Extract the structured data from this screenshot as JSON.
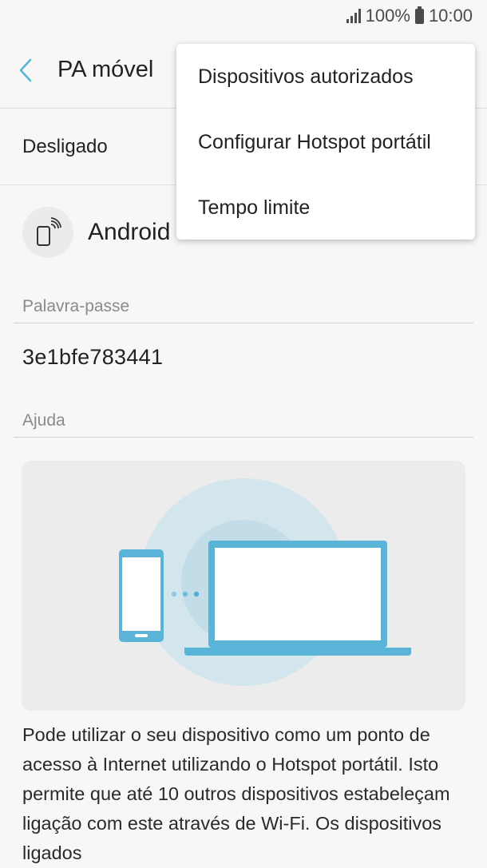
{
  "status_bar": {
    "battery": "100%",
    "time": "10:00"
  },
  "header": {
    "title": "PA móvel"
  },
  "hotspot_status": {
    "label": "Desligado"
  },
  "network": {
    "name": "Android"
  },
  "password": {
    "label": "Palavra-passe",
    "value": "3e1bfe783441"
  },
  "help": {
    "label": "Ajuda",
    "text": "Pode utilizar o seu dispositivo como um ponto de acesso à Internet utilizando o Hotspot portátil. Isto permite que até 10 outros dispositivos estabeleçam ligação com este através de Wi-Fi. Os dispositivos ligados"
  },
  "overflow_menu": {
    "items": [
      {
        "label": "Dispositivos autorizados"
      },
      {
        "label": "Configurar Hotspot portátil"
      },
      {
        "label": "Tempo limite"
      }
    ]
  },
  "colors": {
    "accent": "#5ab4d8",
    "circle_outer": "#cfe4ec",
    "circle_inner": "#bcdbe7"
  },
  "icons": {
    "back": "chevron-left-icon",
    "hotspot": "phone-hotspot-icon",
    "signal": "signal-icon",
    "battery": "battery-icon"
  }
}
